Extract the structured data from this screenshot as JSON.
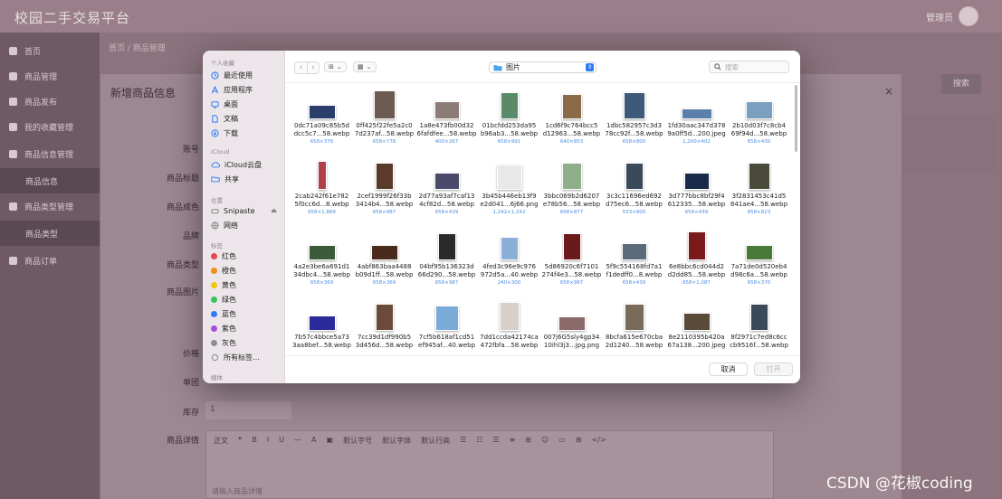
{
  "app": {
    "title": "校园二手交易平台",
    "user_name": "管理员"
  },
  "breadcrumb": "首页 / 商品管理",
  "sidebar": {
    "items": [
      "首页",
      "商品管理",
      "商品发布",
      "我的收藏管理",
      "商品信息管理",
      "商品信息",
      "商品类型管理",
      "商品类型",
      "商品订单"
    ]
  },
  "bg_dialog": {
    "title": "新增商品信息",
    "labels": {
      "id": "账号",
      "title": "商品标题",
      "color": "商品成色",
      "brand": "品牌",
      "type": "商品类型",
      "image": "商品图片",
      "price": "价格",
      "unit": "单团",
      "stock": "库存",
      "detail": "商品详情"
    },
    "stock_value": "1",
    "toolbar": [
      "正文",
      "❝",
      "B",
      "I",
      "U",
      "—",
      "A",
      "▣",
      "默认字号",
      "默认字体",
      "默认行高",
      "☰",
      "☷",
      "☰",
      "≡",
      "⊞",
      "☺",
      "▭",
      "⊞",
      "</>"
    ],
    "editor_placeholder": "请输入商品详情",
    "query_label": "搜索"
  },
  "picker": {
    "sidebar": {
      "sections": {
        "personal": "个人收藏",
        "icloud": "iCloud",
        "locations": "位置",
        "tags": "标签",
        "media": "媒体"
      },
      "favorites": [
        {
          "label": "最近使用",
          "icon": "clock-icon"
        },
        {
          "label": "应用程序",
          "icon": "apps-icon"
        },
        {
          "label": "桌面",
          "icon": "desktop-icon"
        },
        {
          "label": "文稿",
          "icon": "document-icon"
        },
        {
          "label": "下载",
          "icon": "download-icon"
        }
      ],
      "icloud": [
        {
          "label": "iCloud云盘",
          "icon": "cloud-icon"
        },
        {
          "label": "共享",
          "icon": "shared-folder-icon"
        }
      ],
      "locations": [
        {
          "label": "Snipaste",
          "icon": "disk-icon"
        },
        {
          "label": "网络",
          "icon": "network-icon"
        }
      ],
      "tags": [
        {
          "label": "红色",
          "color": "#e5484d"
        },
        {
          "label": "橙色",
          "color": "#f08c1a"
        },
        {
          "label": "黄色",
          "color": "#f1c40f"
        },
        {
          "label": "绿色",
          "color": "#34c759"
        },
        {
          "label": "蓝色",
          "color": "#2f7bf6"
        },
        {
          "label": "紫色",
          "color": "#a550d6"
        },
        {
          "label": "灰色",
          "color": "#8e8e93"
        },
        {
          "label": "所有标签…",
          "color": ""
        }
      ]
    },
    "location": "图片",
    "search_placeholder": "搜索",
    "cancel_label": "取消",
    "open_label": "打开",
    "files": [
      {
        "name1": "0dc71a09c85b5d",
        "name2": "dcc5c7...58.webp",
        "dim": "658×376",
        "c": "#2b3e6b"
      },
      {
        "name1": "0ff425f22fe5a2c0",
        "name2": "7d237af...58.webp",
        "dim": "658×778",
        "c": "#6b5a52"
      },
      {
        "name1": "1a8e473fb00d32",
        "name2": "6fafdfee...58.webp",
        "dim": "400×267",
        "c": "#8c7c78"
      },
      {
        "name1": "01bcfdd253da95",
        "name2": "b96ab3...58.webp",
        "dim": "658×991",
        "c": "#5a8a6a"
      },
      {
        "name1": "1cd6f9c764bcc5",
        "name2": "d12963...58.webp",
        "dim": "640×853",
        "c": "#8b6a4a"
      },
      {
        "name1": "1dbc582957c3d3",
        "name2": "78cc92f...58.webp",
        "dim": "658×800",
        "c": "#3d5a7a"
      },
      {
        "name1": "1fd30aac347d378",
        "name2": "9a0ff5d...200.jpeg",
        "dim": "1,200×402",
        "c": "#5a7fa8"
      },
      {
        "name1": "2b10d03f7c8cb4",
        "name2": "69f94d...58.webp",
        "dim": "658×430",
        "c": "#7a9fbf"
      },
      {
        "name1": "2cab242f61e782",
        "name2": "5f0cc6d...8.webp",
        "dim": "658×1,869",
        "c": "#b0404a"
      },
      {
        "name1": "2cef1999f26f33b",
        "name2": "3414b4...58.webp",
        "dim": "658×987",
        "c": "#5a3a2a"
      },
      {
        "name1": "2d77a93af7caf13",
        "name2": "4cf82d...58.webp",
        "dim": "658×439",
        "c": "#4a4a6a"
      },
      {
        "name1": "3b45b446eb13f9",
        "name2": "e2d041...6j66.png",
        "dim": "1,242×1,242",
        "c": "#e8e8e8"
      },
      {
        "name1": "3bbc069b2d6207",
        "name2": "e78b56...58.webp",
        "dim": "658×877",
        "c": "#8fae8a"
      },
      {
        "name1": "3c3c11696ed692",
        "name2": "d75ec6...58.webp",
        "dim": "533×800",
        "c": "#3a4a5a"
      },
      {
        "name1": "3d777bbc8bf29f4",
        "name2": "612335...58.webp",
        "dim": "658×439",
        "c": "#1a2a4a"
      },
      {
        "name1": "3f2831453c41d5",
        "name2": "841ae4...58.webp",
        "dim": "658×823",
        "c": "#4a4a3a"
      },
      {
        "name1": "4a2e3be6a691d1",
        "name2": "34dbc4...58.webp",
        "dim": "658×369",
        "c": "#3a5a3a"
      },
      {
        "name1": "4abf863baa4488",
        "name2": "b09d1ff...58.webp",
        "dim": "658×369",
        "c": "#4a2a1a"
      },
      {
        "name1": "04bf95b136323d",
        "name2": "66d290...58.webp",
        "dim": "658×987",
        "c": "#2a2a2a"
      },
      {
        "name1": "4fed3c96e9c976",
        "name2": "972d5a...40.webp",
        "dim": "240×300",
        "c": "#8ab0d8"
      },
      {
        "name1": "5d86920c6f7101",
        "name2": "274f4e3...58.webp",
        "dim": "658×987",
        "c": "#6a1a1a"
      },
      {
        "name1": "5f9c554168fd7a1",
        "name2": "f1dedff0...8.webp",
        "dim": "658×439",
        "c": "#5a6a7a"
      },
      {
        "name1": "6e8bbc6cd044d2",
        "name2": "d2dd85...58.webp",
        "dim": "658×1,087",
        "c": "#7a1a1a"
      },
      {
        "name1": "7a71de0d520eb4",
        "name2": "d98c6a...58.webp",
        "dim": "658×370",
        "c": "#4a7a3a"
      },
      {
        "name1": "7b57c4bbce5a73",
        "name2": "3aa8bef...58.webp",
        "dim": "",
        "c": "#2a2a9a"
      },
      {
        "name1": "7cc39d1df990b5",
        "name2": "3d456d...58.webp",
        "dim": "",
        "c": "#6a4a3a"
      },
      {
        "name1": "7cf5b618af1cd51",
        "name2": "ef945af...40.webp",
        "dim": "",
        "c": "#7aaad8"
      },
      {
        "name1": "7dd1ccda42174ca",
        "name2": "472fbfa...58.webp",
        "dim": "",
        "c": "#d8d0c8"
      },
      {
        "name1": "007j6G5sly4gp34",
        "name2": "10ihl3j3...jpg.png",
        "dim": "",
        "c": "#8a6a6a"
      },
      {
        "name1": "8bcfa615e670cba",
        "name2": "2d1240...58.webp",
        "dim": "",
        "c": "#7a6a5a"
      },
      {
        "name1": "8e2110395b420a",
        "name2": "67a138...200.jpeg",
        "dim": "",
        "c": "#5a4a3a"
      },
      {
        "name1": "8f2971c7ed8c6cc",
        "name2": "cb9516f...58.webp",
        "dim": "",
        "c": "#3a4a5a"
      }
    ]
  },
  "watermark": "CSDN @花椒coding"
}
